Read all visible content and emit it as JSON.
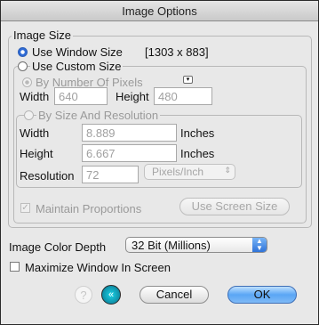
{
  "window": {
    "title": "Image Options"
  },
  "image_size": {
    "group_label": "Image Size",
    "use_window_size_label": "Use Window Size",
    "window_size_value": "[1303 x 883]",
    "use_custom_size_label": "Use Custom Size",
    "by_pixels_label": "By Number Of Pixels",
    "width_label": "Width",
    "width_value": "640",
    "height_label": "Height",
    "height_value": "480",
    "by_resolution_label": "By Size And Resolution",
    "res_width_label": "Width",
    "res_width_value": "8.889",
    "res_width_unit": "Inches",
    "res_height_label": "Height",
    "res_height_value": "6.667",
    "res_height_unit": "Inches",
    "resolution_label": "Resolution",
    "resolution_value": "72",
    "resolution_unit": "Pixels/Inch",
    "maintain_proportions_label": "Maintain Proportions",
    "use_screen_size_label": "Use Screen Size"
  },
  "color_depth": {
    "label": "Image Color Depth",
    "value": "32 Bit (Millions)"
  },
  "maximize": {
    "label": "Maximize Window In Screen"
  },
  "buttons": {
    "cancel": "Cancel",
    "ok": "OK",
    "help": "?",
    "back": "«"
  },
  "icons": {
    "help": "help-icon",
    "back": "back-arrows-icon",
    "popup": "popup-arrow-icon"
  }
}
